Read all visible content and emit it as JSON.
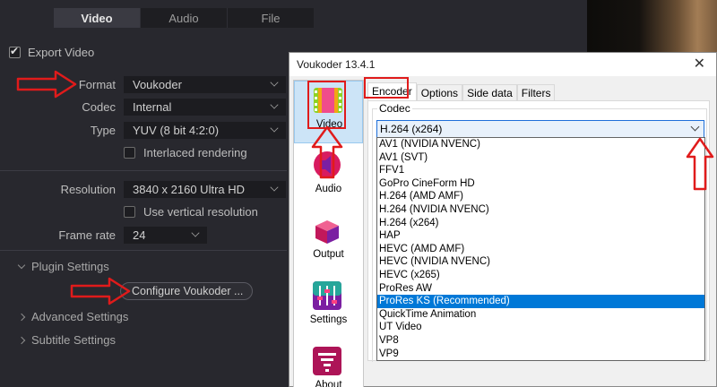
{
  "left_panel": {
    "tabs": [
      "Video",
      "Audio",
      "File"
    ],
    "active_tab": "Video",
    "export_video_label": "Export Video",
    "format_label": "Format",
    "format_value": "Voukoder",
    "codec_label": "Codec",
    "codec_value": "Internal",
    "type_label": "Type",
    "type_value": "YUV (8 bit 4:2:0)",
    "interlaced_label": "Interlaced rendering",
    "resolution_label": "Resolution",
    "resolution_value": "3840 x 2160 Ultra HD",
    "vertical_label": "Use vertical resolution",
    "frame_rate_label": "Frame rate",
    "frame_rate_value": "24",
    "plugin_settings_label": "Plugin Settings",
    "configure_button_label": "Configure Voukoder ...",
    "advanced_settings_label": "Advanced Settings",
    "subtitle_settings_label": "Subtitle Settings"
  },
  "dialog": {
    "title": "Voukoder 13.4.1",
    "close_glyph": "✕",
    "sidebar": [
      {
        "label": "Video",
        "icon": "film-icon",
        "selected": true
      },
      {
        "label": "Audio",
        "icon": "audio-icon",
        "selected": false
      },
      {
        "label": "Output",
        "icon": "box-icon",
        "selected": false
      },
      {
        "label": "Settings",
        "icon": "sliders-icon",
        "selected": false
      },
      {
        "label": "About",
        "icon": "tornado-icon",
        "selected": false
      }
    ],
    "tabs": [
      "Encoder",
      "Options",
      "Side data",
      "Filters"
    ],
    "active_tab": "Encoder",
    "codec_group_label": "Codec",
    "codec_selected": "H.264 (x264)",
    "codec_options": [
      "AV1 (NVIDIA NVENC)",
      "AV1 (SVT)",
      "FFV1",
      "GoPro CineForm HD",
      "H.264 (AMD AMF)",
      "H.264 (NVIDIA NVENC)",
      "H.264 (x264)",
      "HAP",
      "HEVC (AMD AMF)",
      "HEVC (NVIDIA NVENC)",
      "HEVC (x265)",
      "ProRes AW",
      "ProRes KS (Recommended)",
      "QuickTime Animation",
      "UT Video",
      "VP8",
      "VP9"
    ],
    "highlighted_option": "ProRes KS (Recommended)"
  },
  "colors": {
    "annotation_red": "#e01b1b",
    "selection_blue": "#0078d7",
    "panel_dark": "#28282e"
  }
}
